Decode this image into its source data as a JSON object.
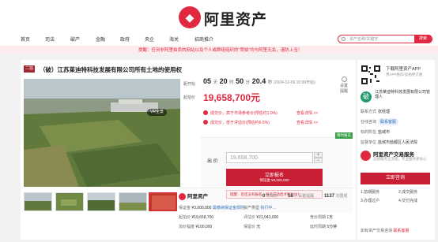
{
  "brand": {
    "logo_glyph": "◆",
    "name": "阿里资产"
  },
  "nav": {
    "items": [
      "首页",
      "司法",
      "破产",
      "金融",
      "政府",
      "央企",
      "海关",
      "招商推介"
    ]
  },
  "search": {
    "placeholder": "资产名称/关键字",
    "button": "搜索"
  },
  "notice": "提醒：任何非阿里拍卖的网站以及个人或群组组织的“竞拍”均与阿里无关，谨防上当！",
  "lot": {
    "tag": "二拍",
    "title": "（破）江苏莱迪特科技发展有限公司所有土地的使用权",
    "countdown_label": "距开始",
    "countdown": {
      "d": "05",
      "d_u": "天",
      "h": "20",
      "h_u": "时",
      "m": "50",
      "m_u": "分",
      "s": "20.4",
      "s_u": "秒"
    },
    "start_note": "(2024-12-09 10:00开始)",
    "remind": "设置提醒",
    "start_price_label": "起拍价",
    "start_price": "19,658,700元",
    "compare1": {
      "text": "成交价，高于市场参考价(预估约1.0%)",
      "link": "查看详情 >>"
    },
    "compare2": {
      "text": "成交价，低于评估价(预估约6.5%)",
      "link": "查看详情 >>"
    },
    "green_tag": "限时报名",
    "bid_label": "出 价",
    "bid_value": "19,658,700",
    "register_main": "立即报名",
    "register_sub": "保证金 ¥3,000,000",
    "register_tip": "提醒：您还没有报名，报名成功后才能出价！",
    "vr_label": "VR全景"
  },
  "sub": {
    "brand": "阿里资产",
    "stats": [
      {
        "n": "0",
        "l": "次出价"
      },
      {
        "n": "18",
        "l": "人设置提醒"
      },
      {
        "n": "1137",
        "l": "次围观"
      }
    ],
    "details": [
      {
        "k": "保证金",
        "v": "¥3,000,000",
        "x": "需缴纳保证金规则"
      },
      {
        "k": "起拍价",
        "v": "¥19,658,700",
        "x": ""
      },
      {
        "k": "加价幅度",
        "v": "¥100,000",
        "x": ""
      },
      {
        "k": "竞价周期",
        "v": "1天",
        "x": ""
      },
      {
        "k": "延时周期",
        "v": "5分钟",
        "x": ""
      },
      {
        "k": "评估价",
        "v": "¥21,043,000",
        "x": ""
      },
      {
        "k": "保留价",
        "v": "无",
        "x": ""
      },
      {
        "k": "优先购买权人",
        "v": "有",
        "x": ""
      },
      {
        "k": "资产类型",
        "v": "土地",
        "x": "执行中…"
      }
    ]
  },
  "side": {
    "app_title": "下载阿里资产APP",
    "app_sub": "用APP看房/竞拍更方便",
    "org": "江苏莱迪特科技发展有限公司管理人",
    "rows": [
      {
        "k": "联系方式",
        "v": "张经理"
      },
      {
        "k": "在线咨询",
        "v": "联系客服"
      },
      {
        "k": "标的所在",
        "v": "盐城市"
      },
      {
        "k": "监督单位",
        "v": "盐城市盐都区人民法院"
      }
    ],
    "svc_title": "阿里资产交易服务",
    "svc_sub": "竞拍服务全流程，专业服务更省心",
    "consult": "立即咨询",
    "steps": [
      "1.前期服务",
      "2.成交服务",
      "3.办理过户",
      "4.交付完成"
    ],
    "follow": "如有资产交易咨询",
    "follow_link": "联系客服"
  }
}
